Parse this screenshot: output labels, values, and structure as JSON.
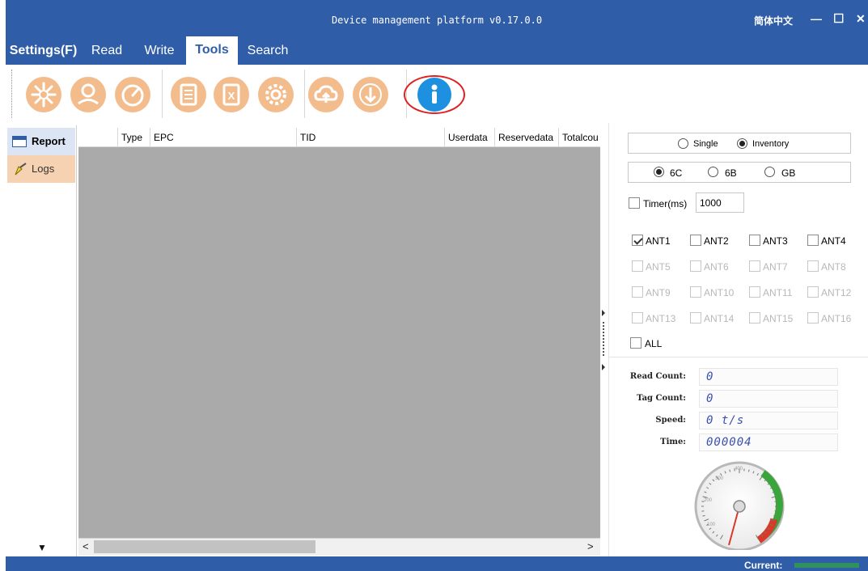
{
  "window": {
    "title": "Device management platform v0.17.0.0",
    "language": "简体中文",
    "minimize_glyph": "—",
    "maximize_glyph": "☐",
    "close_glyph": "✕"
  },
  "menu": [
    {
      "label": "Settings(F)"
    },
    {
      "label": "Read"
    },
    {
      "label": "Write"
    },
    {
      "label": "Tools",
      "active": true
    },
    {
      "label": "Search"
    }
  ],
  "toolbar": {
    "icons": [
      "snowflake-icon",
      "user-icon",
      "speedometer-icon",
      "document-icon",
      "excel-icon",
      "gear-icon",
      "cloud-upload-icon",
      "download-icon",
      "info-icon"
    ],
    "accent": "#f3bc8d",
    "info_color": "#1e90e0",
    "highlight_color": "#e02020"
  },
  "sidebar": {
    "items": [
      {
        "label": "Report",
        "icon": "window-icon",
        "active": true
      },
      {
        "label": "Logs",
        "icon": "broom-icon"
      }
    ],
    "scroll_glyph": "▼"
  },
  "grid": {
    "columns": [
      "Type",
      "EPC",
      "TID",
      "Userdata",
      "Reservedata",
      "Totalcou"
    ],
    "body_color": "#aaaaaa",
    "scroll_left": "<",
    "scroll_right": ">"
  },
  "panel": {
    "mode_options": [
      {
        "label": "Single"
      },
      {
        "label": "Inventory",
        "selected": true
      }
    ],
    "protocol_options": [
      {
        "label": "6C",
        "selected": true
      },
      {
        "label": "6B"
      },
      {
        "label": "GB"
      }
    ],
    "timer": {
      "label": "Timer(ms)",
      "value": "1000"
    },
    "antennas": [
      {
        "label": "ANT1",
        "checked": true
      },
      {
        "label": "ANT2"
      },
      {
        "label": "ANT3"
      },
      {
        "label": "ANT4"
      },
      {
        "label": "ANT5",
        "disabled": true
      },
      {
        "label": "ANT6",
        "disabled": true
      },
      {
        "label": "ANT7",
        "disabled": true
      },
      {
        "label": "ANT8",
        "disabled": true
      },
      {
        "label": "ANT9",
        "disabled": true
      },
      {
        "label": "ANT10",
        "disabled": true
      },
      {
        "label": "ANT11",
        "disabled": true
      },
      {
        "label": "ANT12",
        "disabled": true
      },
      {
        "label": "ANT13",
        "disabled": true
      },
      {
        "label": "ANT14",
        "disabled": true
      },
      {
        "label": "ANT15",
        "disabled": true
      },
      {
        "label": "ANT16",
        "disabled": true
      }
    ],
    "all_label": "ALL",
    "stats": {
      "read_count_label": "Read Count:",
      "read_count": "0",
      "tag_count_label": "Tag Count:",
      "tag_count": "0",
      "speed_label": "Speed:",
      "speed": "0 t/s",
      "time_label": "Time:",
      "time": "000004"
    },
    "gauge": {
      "ticks": [
        "100",
        "200",
        "300",
        "400"
      ],
      "value_fraction": 0.02
    }
  },
  "statusbar": {
    "current_label": "Current:"
  },
  "colors": {
    "brand": "#2f5da8",
    "toolbar_accent": "#f3bc8d"
  }
}
